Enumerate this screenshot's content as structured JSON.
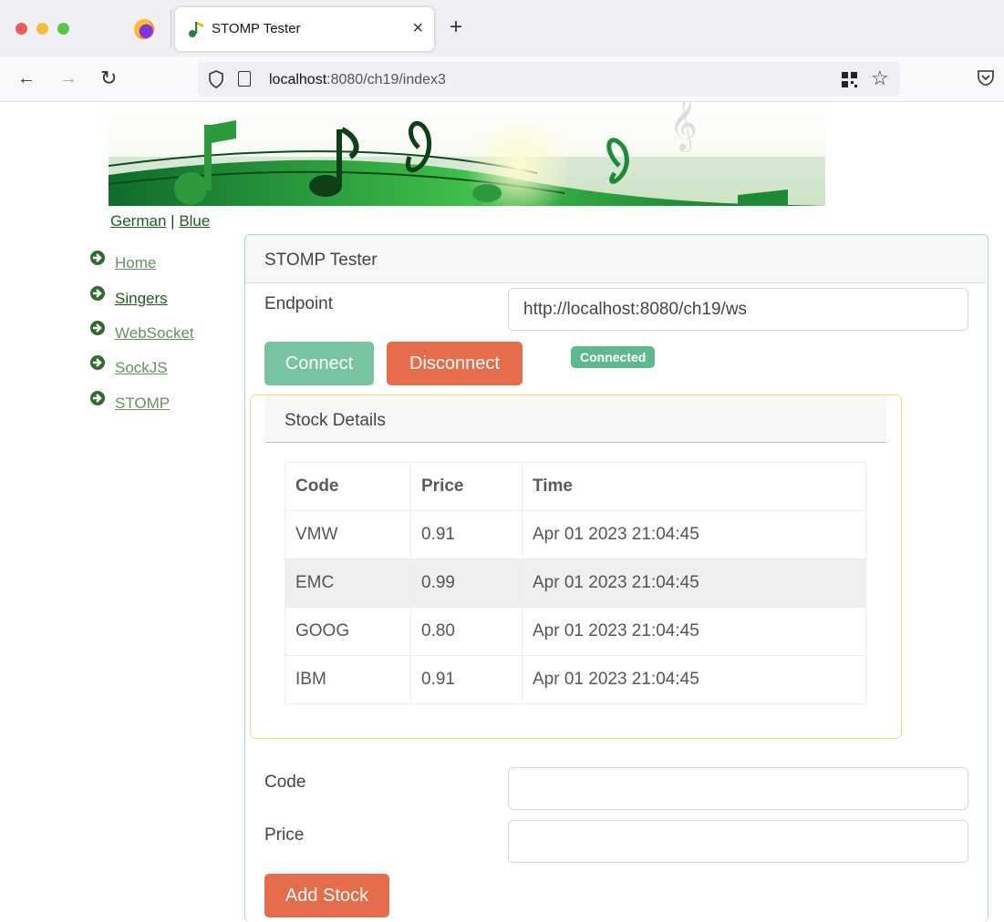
{
  "browser": {
    "tab_title": "STOMP Tester",
    "tab_close": "×",
    "new_tab": "+",
    "url_host": "localhost",
    "url_rest": ":8080/ch19/index3",
    "icons": [
      "back-icon",
      "forward-icon",
      "reload-icon",
      "shield-icon",
      "page-icon",
      "qr-icon",
      "bookmark-star-icon",
      "pocket-icon"
    ]
  },
  "page": {
    "lang": {
      "german": "German",
      "separator": "|",
      "blue": "Blue"
    },
    "sidebar": {
      "items": [
        {
          "label": "Home"
        },
        {
          "label": "Singers"
        },
        {
          "label": "WebSocket"
        },
        {
          "label": "SockJS"
        },
        {
          "label": "STOMP"
        }
      ]
    },
    "card": {
      "title": "STOMP Tester",
      "endpoint_label": "Endpoint",
      "endpoint_value": "http://localhost:8080/ch19/ws",
      "connect_label": "Connect",
      "disconnect_label": "Disconnect",
      "status_badge": "Connected",
      "stock": {
        "title": "Stock Details",
        "headers": {
          "code": "Code",
          "price": "Price",
          "time": "Time"
        },
        "rows": [
          {
            "code": "VMW",
            "price": "0.91",
            "time": "Apr 01 2023 21:04:45"
          },
          {
            "code": "EMC",
            "price": "0.99",
            "time": "Apr 01 2023 21:04:45"
          },
          {
            "code": "GOOG",
            "price": "0.80",
            "time": "Apr 01 2023 21:04:45"
          },
          {
            "code": "IBM",
            "price": "0.91",
            "time": "Apr 01 2023 21:04:45"
          }
        ]
      },
      "code_label": "Code",
      "code_value": "",
      "price_label": "Price",
      "price_value": "",
      "add_label": "Add Stock"
    },
    "colors": {
      "accent_green": "#78c3a0",
      "danger_orange": "#e66d4c",
      "badge_green": "#5fb98e",
      "link_green": "#1e5d22"
    }
  }
}
